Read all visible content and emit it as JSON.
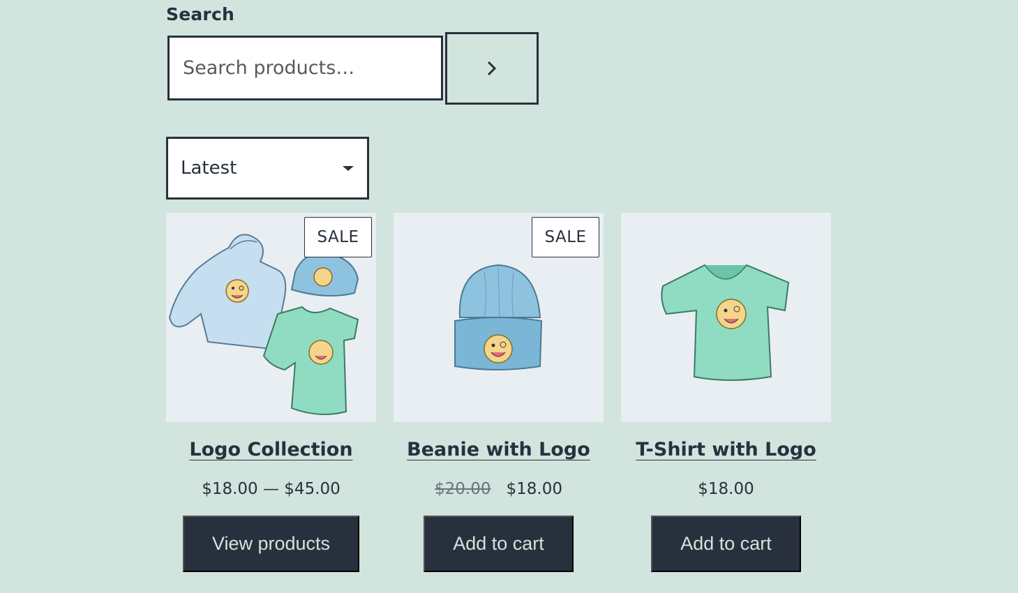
{
  "search": {
    "label": "Search",
    "placeholder": "Search products…",
    "value": "",
    "submit_icon": "chevron-right-icon"
  },
  "sort": {
    "selected": "Latest",
    "icon": "caret-down-icon"
  },
  "colors": {
    "background": "#d1e4dd",
    "text": "#28303d",
    "button_bg": "#28303d",
    "button_text": "#d1e4dd",
    "image_bg": "#e9eef2"
  },
  "products": [
    {
      "title": "Logo Collection",
      "badge": "SALE",
      "price": "$18.00 — $45.00",
      "old_price": "",
      "button": "View products"
    },
    {
      "title": "Beanie with Logo",
      "badge": "SALE",
      "price": "$18.00",
      "old_price": "$20.00",
      "button": "Add to cart"
    },
    {
      "title": "T-Shirt with Logo",
      "badge": "",
      "price": "$18.00",
      "old_price": "",
      "button": "Add to cart"
    }
  ]
}
